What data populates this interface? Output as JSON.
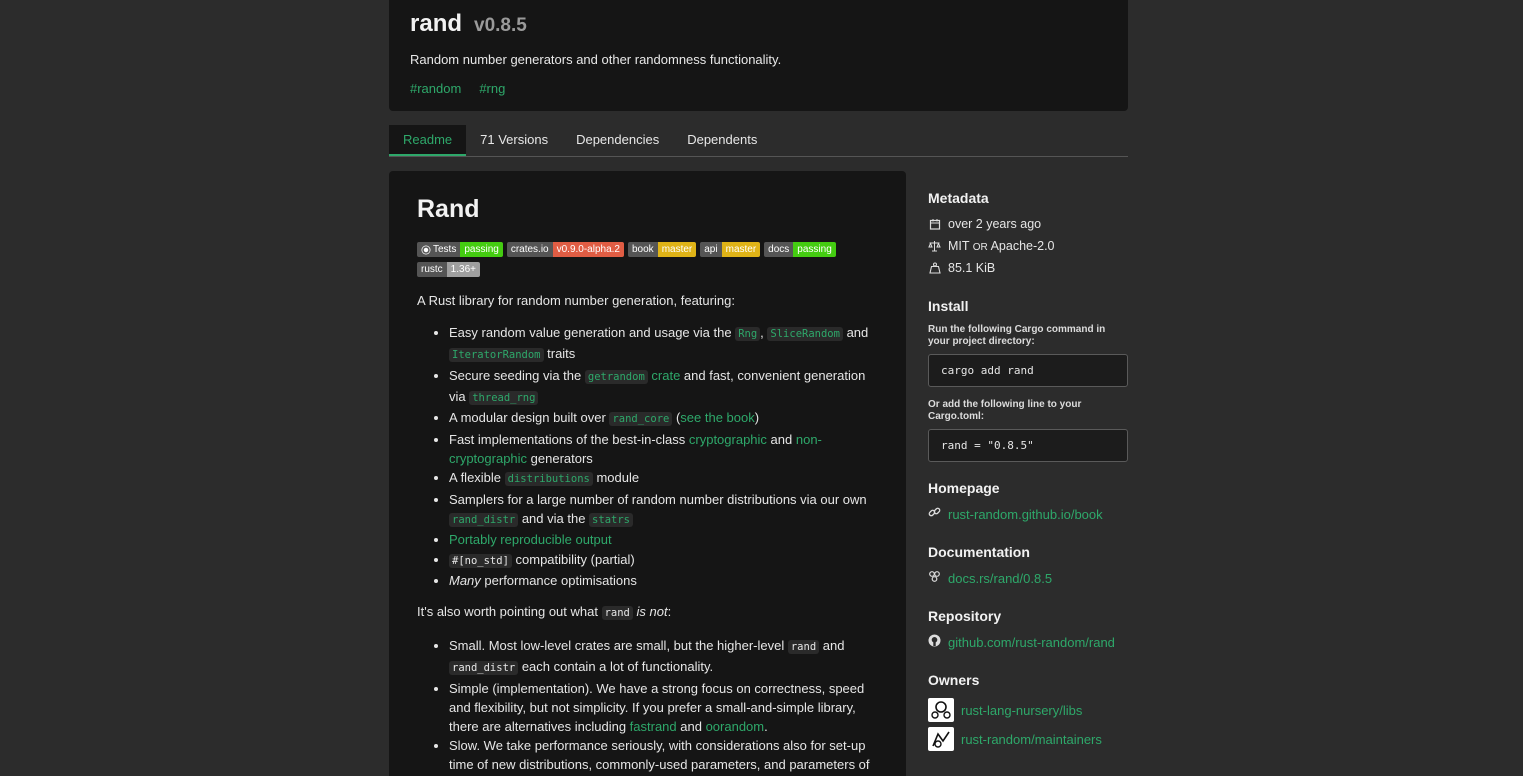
{
  "header": {
    "name": "rand",
    "version": "v0.8.5",
    "description": "Random number generators and other randomness functionality.",
    "keywords": [
      "#random",
      "#rng"
    ]
  },
  "tabs": [
    {
      "label": "Readme",
      "active": true
    },
    {
      "label": "71 Versions"
    },
    {
      "label": "Dependencies"
    },
    {
      "label": "Dependents"
    }
  ],
  "readme": {
    "title": "Rand",
    "badges": [
      {
        "left": "Tests",
        "right": "passing",
        "color": "#4c1",
        "icon": "github-icon"
      },
      {
        "left": "crates.io",
        "right": "v0.9.0-alpha.2",
        "color": "#e05d44"
      },
      {
        "left": "book",
        "right": "master",
        "color": "#dfb317"
      },
      {
        "left": "api",
        "right": "master",
        "color": "#dfb317"
      },
      {
        "left": "docs",
        "right": "passing",
        "color": "#4c1"
      },
      {
        "left": "rustc",
        "right": "1.36+",
        "color": "#9f9f9f"
      }
    ],
    "intro": "A Rust library for random number generation, featuring:",
    "features": {
      "f1_a": "Easy random value generation and usage via the ",
      "f1_c1": "Rng",
      "f1_b": ", ",
      "f1_c2": "SliceRandom",
      "f1_d": " and ",
      "f1_c3": "IteratorRandom",
      "f1_e": " traits",
      "f2_a": "Secure seeding via the ",
      "f2_c1": "getrandom",
      "f2_l1": " crate",
      "f2_b": " and fast, convenient generation via ",
      "f2_c2": "thread_rng",
      "f3_a": "A modular design built over ",
      "f3_c1": "rand_core",
      "f3_b": " (",
      "f3_l1": "see the book",
      "f3_c": ")",
      "f4_a": "Fast implementations of the best-in-class ",
      "f4_l1": "cryptographic",
      "f4_b": " and ",
      "f4_l2": "non-cryptographic",
      "f4_c": " generators",
      "f5_a": "A flexible ",
      "f5_c1": "distributions",
      "f5_b": " module",
      "f6_a": "Samplers for a large number of random number distributions via our own ",
      "f6_c1": "rand_distr",
      "f6_b": " and via the ",
      "f6_c2": "statrs",
      "f7_l1": "Portably reproducible output",
      "f8_c1": "#[no_std]",
      "f8_a": " compatibility (partial)",
      "f9_em": "Many",
      "f9_a": " performance optimisations"
    },
    "not_intro_a": "It's also worth pointing out what ",
    "not_intro_code": "rand",
    "not_intro_em": " is not",
    "not_intro_b": ":",
    "nots": {
      "n1_a": "Small. Most low-level crates are small, but the higher-level ",
      "n1_c1": "rand",
      "n1_b": " and ",
      "n1_c2": "rand_distr",
      "n1_c": " each contain a lot of functionality.",
      "n2_a": "Simple (implementation). We have a strong focus on correctness, speed and flexibility, but not simplicity. If you prefer a small-and-simple library, there are alternatives including ",
      "n2_l1": "fastrand",
      "n2_b": " and ",
      "n2_l2": "oorandom",
      "n2_c": ".",
      "n3": "Slow. We take performance seriously, with considerations also for set-up time of new distributions, commonly-used parameters, and parameters of the current sampler."
    }
  },
  "sidebar": {
    "metadata_title": "Metadata",
    "published": "over 2 years ago",
    "license_a": "MIT",
    "license_or": "OR",
    "license_b": "Apache-2.0",
    "size": "85.1 KiB",
    "install_title": "Install",
    "install_note": "Run the following Cargo command in your project directory:",
    "install_cmd": "cargo add rand",
    "toml_note": "Or add the following line to your Cargo.toml:",
    "toml_line": "rand = \"0.8.5\"",
    "homepage_title": "Homepage",
    "homepage": "rust-random.github.io/book",
    "documentation_title": "Documentation",
    "documentation": "docs.rs/rand/0.8.5",
    "repository_title": "Repository",
    "repository": "github.com/rust-random/rand",
    "owners_title": "Owners",
    "owners": [
      "rust-lang-nursery/libs",
      "rust-random/maintainers"
    ]
  }
}
